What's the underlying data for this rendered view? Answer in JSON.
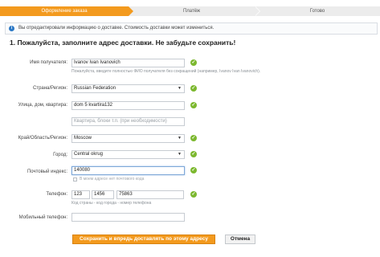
{
  "steps": [
    {
      "label": "Оформление заказа"
    },
    {
      "label": "Платёж"
    },
    {
      "label": "Готово"
    }
  ],
  "notice": {
    "icon": "info-icon",
    "text": "Вы отредактировали информацию о доставке. Стоимость доставки может измениться."
  },
  "section_title": "1. Пожалуйста, заполните адрес доставки. Не забудьте сохранить!",
  "form": {
    "recipient": {
      "label": "Имя получателя:",
      "value": "Ivanov Ivan Ivanovich",
      "hint": "Пожалуйста, введите полностью ФИО получателя без сокращений (например, Ivanov Ivan Ivanovich)."
    },
    "country": {
      "label": "Страна/Регион:",
      "value": "Russian Federation"
    },
    "street": {
      "label": "Улица, дом, квартира:",
      "value": "dom 5 kvartira132"
    },
    "street2": {
      "placeholder": "Квартира, блоки т.п. (при необходимости)"
    },
    "region": {
      "label": "Край/Область/Регион:",
      "value": "Moscow"
    },
    "city": {
      "label": "Город:",
      "value": "Central okrug"
    },
    "zip": {
      "label": "Почтовый индекс:",
      "value": "140080",
      "checkbox_label": "В моем адресе нет почтового кода"
    },
    "phone": {
      "label": "Телефон:",
      "country_code": "123",
      "area_code": "1456",
      "number": "75863",
      "hint": "Код страны - код города - номер телефона"
    },
    "mobile": {
      "label": "Мобильный телефон:",
      "value": ""
    }
  },
  "buttons": {
    "save": "Сохранить и впредь доставлять по этому адресу",
    "cancel": "Отмена"
  },
  "colors": {
    "accent": "#f39a1e",
    "ok": "#7cb82f",
    "info": "#2b78c5"
  }
}
